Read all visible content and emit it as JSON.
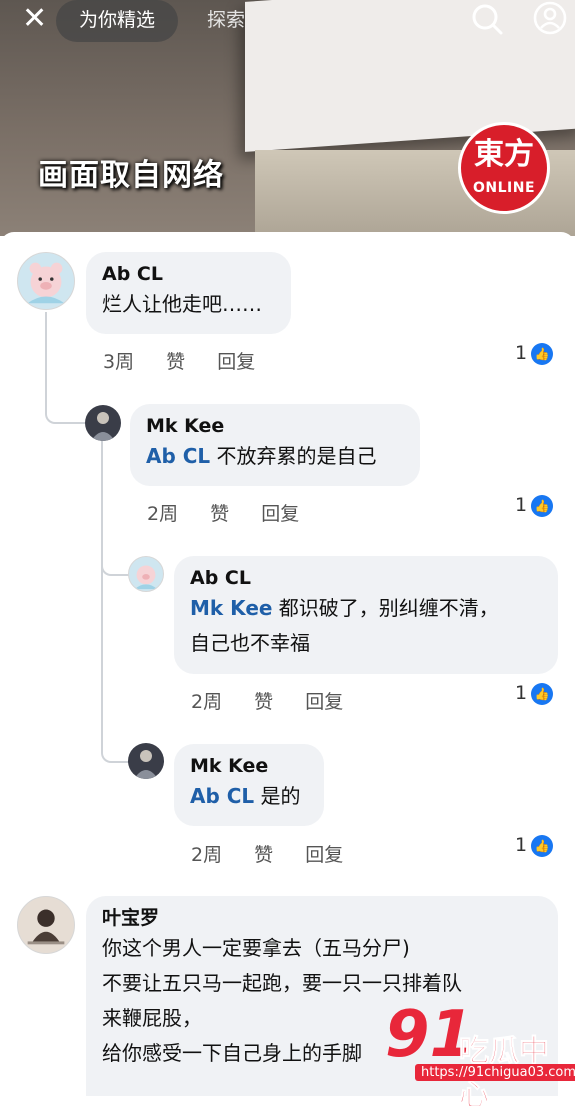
{
  "topbar": {
    "close": "✕",
    "tab_active": "为你精选",
    "tab_explore": "探索"
  },
  "video": {
    "caption": "画面取自网络",
    "logo_line1": "東方",
    "logo_line2": "ONLINE"
  },
  "comments": [
    {
      "author": "Ab CL",
      "mention": "",
      "text": "烂人让他走吧……",
      "time": "3周",
      "like": "赞",
      "reply": "回复",
      "likes": "1"
    },
    {
      "author": "Mk Kee",
      "mention": "Ab CL",
      "text": " 不放弃累的是自己",
      "time": "2周",
      "like": "赞",
      "reply": "回复",
      "likes": "1"
    },
    {
      "author": "Ab CL",
      "mention": "Mk Kee",
      "text": " 都识破了，别纠缠不清，",
      "text2": "自己也不幸福",
      "time": "2周",
      "like": "赞",
      "reply": "回复",
      "likes": "1"
    },
    {
      "author": "Mk Kee",
      "mention": "Ab CL",
      "text": " 是的",
      "time": "2周",
      "like": "赞",
      "reply": "回复",
      "likes": "1"
    },
    {
      "author": "叶宝罗",
      "lines": [
        "你这个男人一定要拿去（五马分尸)",
        "不要让五只马一起跑，要一只一只排着队",
        "来鞭屁股，",
        "给你感受一下自己身上的手脚"
      ]
    }
  ],
  "watermark": {
    "num": "91",
    "text": "吃瓜中心",
    "url": "https://91chigua03.com"
  },
  "colors": {
    "mention": "#1f5fa8",
    "like_badge": "#1877f2",
    "bubble": "#f0f2f5"
  }
}
